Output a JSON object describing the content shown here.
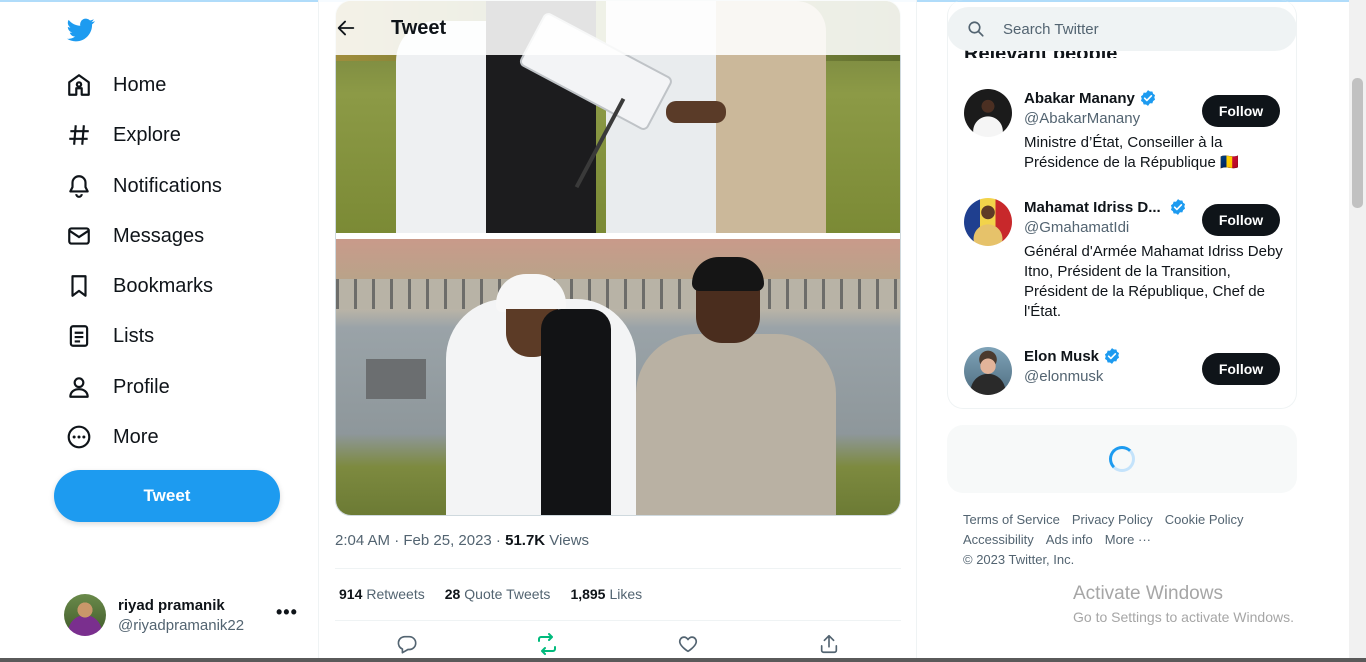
{
  "nav": {
    "items": [
      {
        "label": "Home",
        "icon": "home-icon"
      },
      {
        "label": "Explore",
        "icon": "hashtag-icon"
      },
      {
        "label": "Notifications",
        "icon": "bell-icon"
      },
      {
        "label": "Messages",
        "icon": "envelope-icon"
      },
      {
        "label": "Bookmarks",
        "icon": "bookmark-icon"
      },
      {
        "label": "Lists",
        "icon": "list-icon"
      },
      {
        "label": "Profile",
        "icon": "person-icon"
      },
      {
        "label": "More",
        "icon": "more-circle-icon"
      }
    ],
    "tweet_button": "Tweet"
  },
  "account": {
    "name": "riyad pramanik",
    "handle": "@riyadpramanik22",
    "more": "•••"
  },
  "header": {
    "title": "Tweet"
  },
  "tweet": {
    "time": "2:04 AM · Feb 25, 2023 · ",
    "views_count": "51.7K",
    "views_label": " Views",
    "retweets_count": "914",
    "retweets_label": "Retweets",
    "quotes_count": "28",
    "quotes_label": "Quote Tweets",
    "likes_count": "1,895",
    "likes_label": "Likes"
  },
  "search": {
    "placeholder": "Search Twitter"
  },
  "relevant": {
    "title": "Relevant people",
    "people": [
      {
        "name": "Abakar Manany",
        "handle": "@AbakarManany",
        "bio": "Ministre d’État, Conseiller à la Présidence de la République 🇹🇩",
        "follow": "Follow"
      },
      {
        "name": "Mahamat Idriss D...",
        "handle": "@GmahamatIdi",
        "bio": "Général d'Armée Mahamat Idriss Deby Itno, Président de la Transition, Président de la République, Chef de l'État.",
        "follow": "Follow"
      },
      {
        "name": "Elon Musk",
        "handle": "@elonmusk",
        "bio": "",
        "follow": "Follow"
      }
    ]
  },
  "footer": {
    "links_row1": [
      "Terms of Service",
      "Privacy Policy",
      "Cookie Policy"
    ],
    "links_row2": [
      "Accessibility",
      "Ads info",
      "More ···"
    ],
    "copyright": "© 2023 Twitter, Inc."
  },
  "watermark": {
    "line1": "Activate Windows",
    "line2": "Go to Settings to activate Windows."
  },
  "colors": {
    "accent": "#1d9bf0",
    "text": "#0f1419",
    "muted": "#536471",
    "retweet_green": "#00ba7c"
  }
}
